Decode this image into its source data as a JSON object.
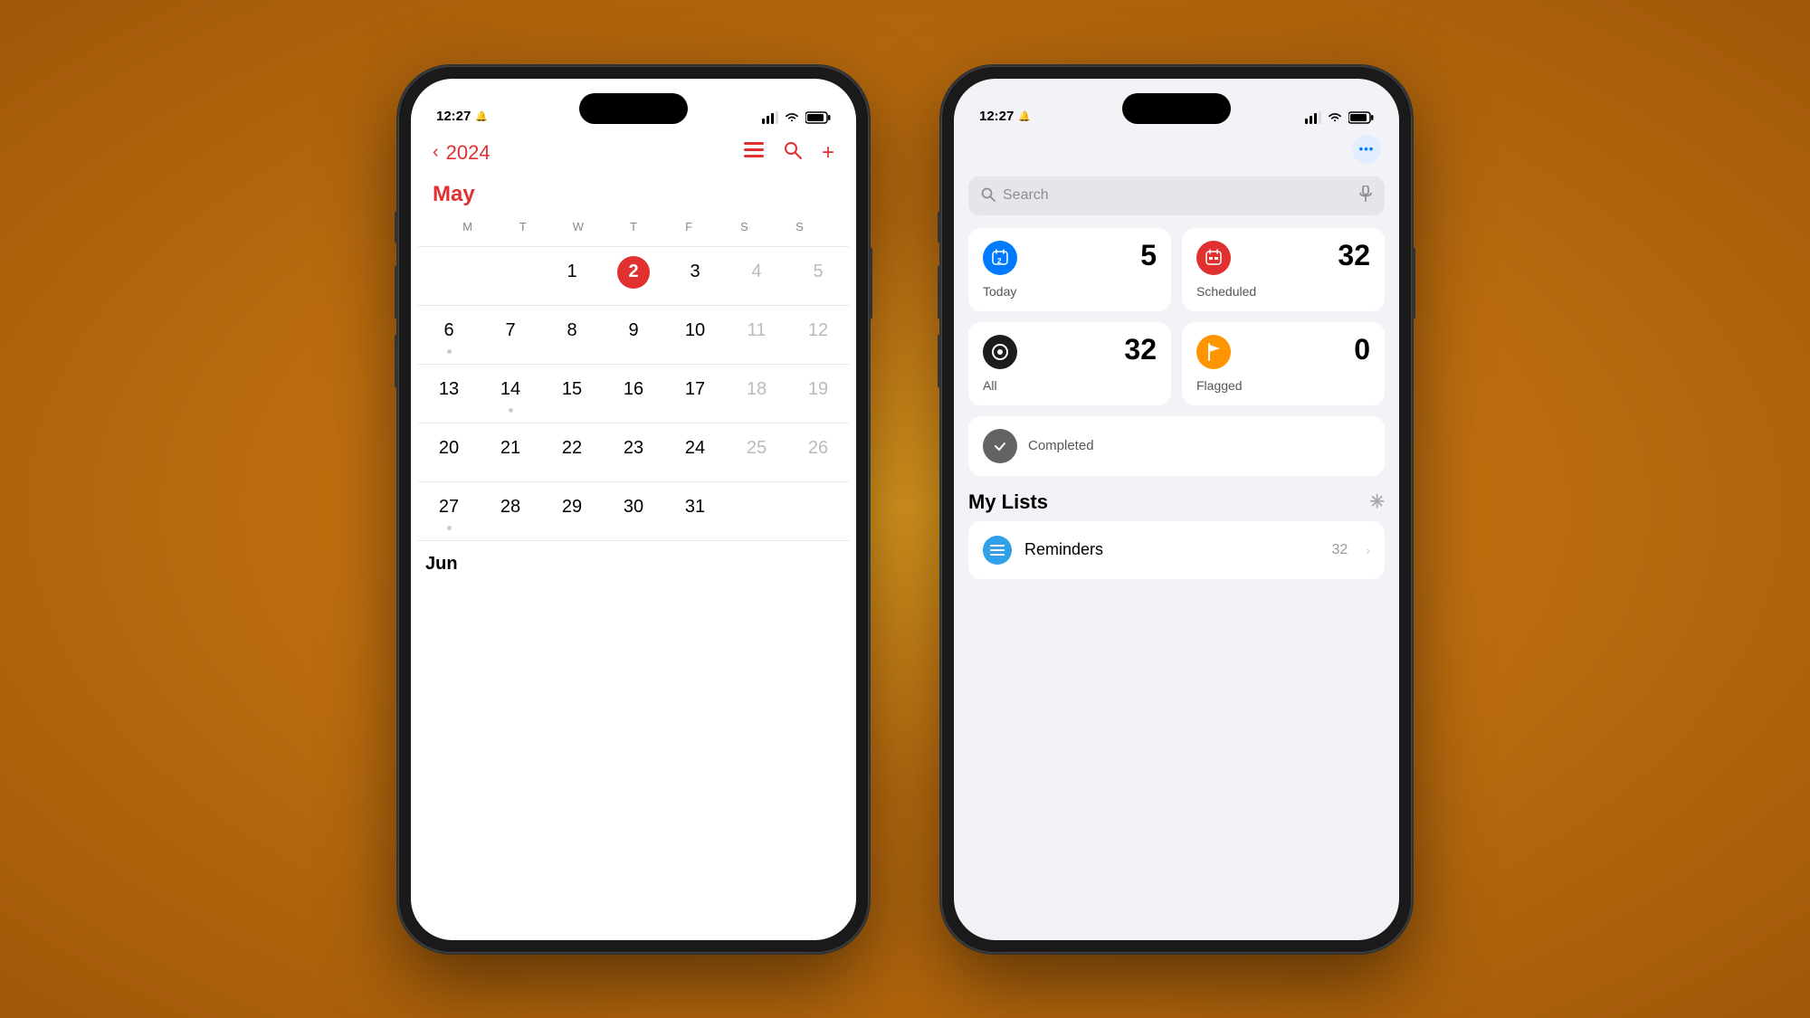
{
  "background": "radial-gradient(ellipse at center, #e8a020 0%, #c07010 40%, #a05808 100%)",
  "phone_left": {
    "status_bar": {
      "time": "12:27",
      "bell_icon": "🔔",
      "signal_bars": "▂▄▆",
      "wifi_icon": "wifi",
      "battery_icon": "battery"
    },
    "calendar": {
      "year": "2024",
      "month": "May",
      "next_month": "Jun",
      "day_headers": [
        "M",
        "T",
        "W",
        "T",
        "F",
        "S",
        "S"
      ],
      "weeks": [
        {
          "days": [
            {
              "num": "",
              "style": "empty"
            },
            {
              "num": "",
              "style": "empty"
            },
            {
              "num": "1",
              "style": "normal"
            },
            {
              "num": "2",
              "style": "today"
            },
            {
              "num": "3",
              "style": "normal"
            },
            {
              "num": "4",
              "style": "weekend"
            },
            {
              "num": "5",
              "style": "weekend"
            }
          ],
          "dots": [
            false,
            false,
            false,
            false,
            false,
            false,
            false
          ]
        },
        {
          "days": [
            {
              "num": "6",
              "style": "normal"
            },
            {
              "num": "7",
              "style": "normal"
            },
            {
              "num": "8",
              "style": "normal"
            },
            {
              "num": "9",
              "style": "normal"
            },
            {
              "num": "10",
              "style": "normal"
            },
            {
              "num": "11",
              "style": "weekend"
            },
            {
              "num": "12",
              "style": "weekend"
            }
          ],
          "dots": [
            true,
            false,
            false,
            false,
            false,
            false,
            false
          ]
        },
        {
          "days": [
            {
              "num": "13",
              "style": "normal"
            },
            {
              "num": "14",
              "style": "normal"
            },
            {
              "num": "15",
              "style": "normal"
            },
            {
              "num": "16",
              "style": "normal"
            },
            {
              "num": "17",
              "style": "normal"
            },
            {
              "num": "18",
              "style": "weekend"
            },
            {
              "num": "19",
              "style": "weekend"
            }
          ],
          "dots": [
            false,
            true,
            false,
            false,
            false,
            false,
            false
          ]
        },
        {
          "days": [
            {
              "num": "20",
              "style": "normal"
            },
            {
              "num": "21",
              "style": "normal"
            },
            {
              "num": "22",
              "style": "normal"
            },
            {
              "num": "23",
              "style": "normal"
            },
            {
              "num": "24",
              "style": "normal"
            },
            {
              "num": "25",
              "style": "weekend"
            },
            {
              "num": "26",
              "style": "weekend"
            }
          ],
          "dots": [
            false,
            false,
            false,
            false,
            false,
            false,
            false
          ]
        },
        {
          "days": [
            {
              "num": "27",
              "style": "normal"
            },
            {
              "num": "28",
              "style": "normal"
            },
            {
              "num": "29",
              "style": "normal"
            },
            {
              "num": "30",
              "style": "normal"
            },
            {
              "num": "31",
              "style": "normal"
            },
            {
              "num": "",
              "style": "empty"
            },
            {
              "num": "",
              "style": "empty"
            }
          ],
          "dots": [
            true,
            false,
            false,
            false,
            false,
            false,
            false
          ]
        }
      ]
    }
  },
  "phone_right": {
    "status_bar": {
      "time": "12:27",
      "bell_icon": "🔔",
      "signal_bars": "▂▄▆",
      "wifi_icon": "wifi",
      "battery_icon": "battery"
    },
    "reminders": {
      "search_placeholder": "Search",
      "more_button_label": "•••",
      "cards": [
        {
          "id": "today",
          "icon_class": "icon-blue",
          "icon": "■",
          "count": "5",
          "label": "Today"
        },
        {
          "id": "scheduled",
          "icon_class": "icon-red",
          "icon": "▦",
          "count": "32",
          "label": "Scheduled"
        },
        {
          "id": "all",
          "icon_class": "icon-black",
          "icon": "⊕",
          "count": "32",
          "label": "All"
        },
        {
          "id": "flagged",
          "icon_class": "icon-orange",
          "icon": "⚑",
          "count": "0",
          "label": "Flagged"
        }
      ],
      "completed_label": "Completed",
      "my_lists_label": "My Lists",
      "list_items": [
        {
          "name": "Reminders",
          "count": "32",
          "icon_class": "icon-lightblue",
          "icon": "≡"
        }
      ]
    }
  }
}
